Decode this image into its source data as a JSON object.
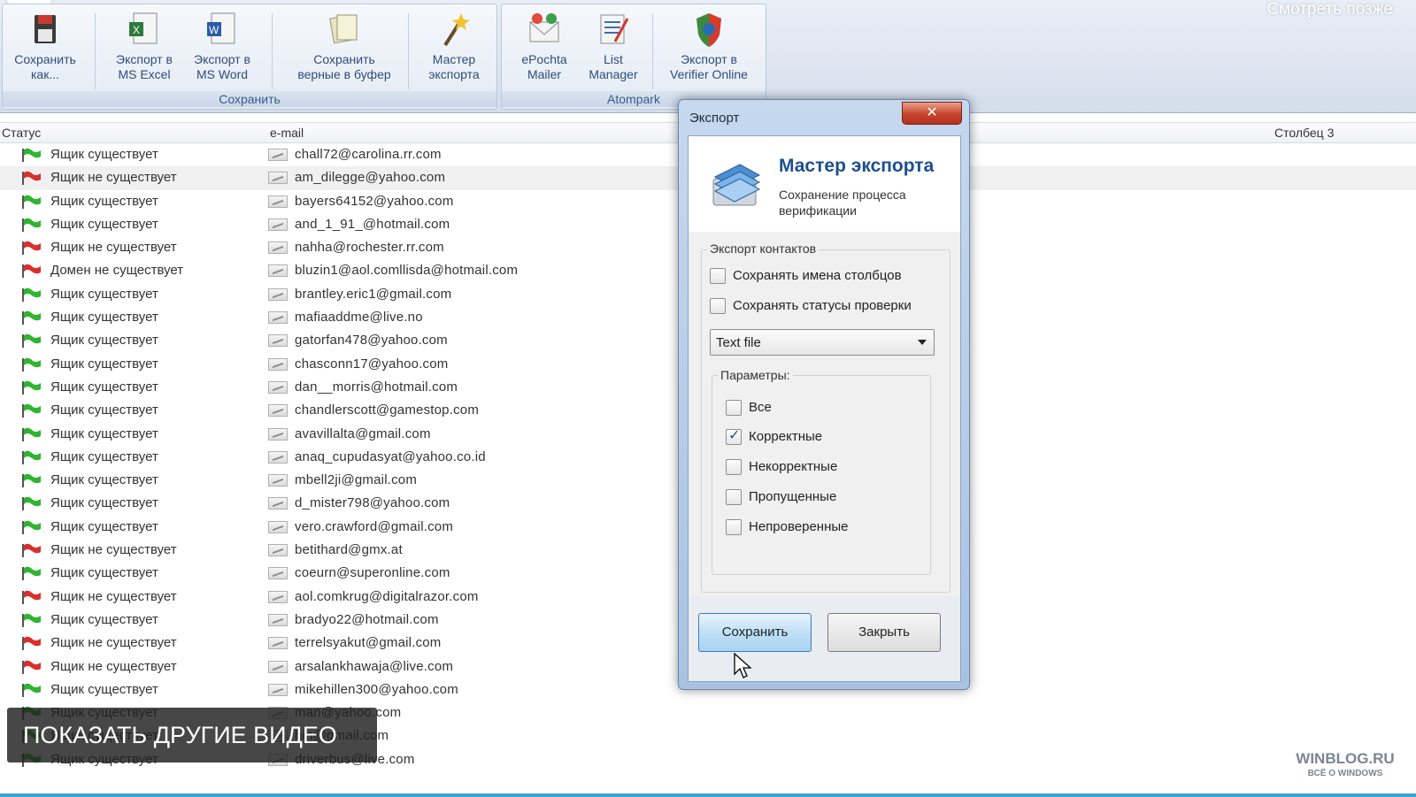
{
  "ribbon": {
    "watch_later": "Смотреть позже",
    "groups": [
      {
        "label": "Сохранить"
      },
      {
        "label": "Atompark"
      }
    ],
    "buttons": [
      {
        "label": "Сохранить\nкак...",
        "icon": "save-as-icon"
      },
      {
        "label": "Экспорт в\nMS Excel",
        "icon": "excel-export-icon"
      },
      {
        "label": "Экспорт в\nMS Word",
        "icon": "word-export-icon"
      },
      {
        "label": "Сохранить\nверные в буфер",
        "icon": "clipboard-save-icon"
      },
      {
        "label": "Мастер\nэкспорта",
        "icon": "export-wizard-icon"
      },
      {
        "label": "ePochta\nMailer",
        "icon": "epochta-mailer-icon"
      },
      {
        "label": "List\nManager",
        "icon": "list-manager-icon"
      },
      {
        "label": "Экспорт в\nVerifier Online",
        "icon": "verifier-online-icon"
      }
    ]
  },
  "table": {
    "columns": [
      "Статус",
      "e-mail",
      "Столбец 3"
    ],
    "rows": [
      {
        "status": "Ящик существует",
        "ok": true,
        "email": "chall72@carolina.rr.com"
      },
      {
        "status": "Ящик не существует",
        "ok": false,
        "email": "am_dilegge@yahoo.com"
      },
      {
        "status": "Ящик существует",
        "ok": true,
        "email": "bayers64152@yahoo.com"
      },
      {
        "status": "Ящик существует",
        "ok": true,
        "email": "and_1_91_@hotmail.com"
      },
      {
        "status": "Ящик не существует",
        "ok": false,
        "email": "nahha@rochester.rr.com"
      },
      {
        "status": "Домен не существует",
        "ok": false,
        "email": "bluzin1@aol.comllisda@hotmail.com"
      },
      {
        "status": "Ящик существует",
        "ok": true,
        "email": "brantley.eric1@gmail.com"
      },
      {
        "status": "Ящик существует",
        "ok": true,
        "email": "mafiaaddme@live.no"
      },
      {
        "status": "Ящик существует",
        "ok": true,
        "email": "gatorfan478@yahoo.com"
      },
      {
        "status": "Ящик существует",
        "ok": true,
        "email": "chasconn17@yahoo.com"
      },
      {
        "status": "Ящик существует",
        "ok": true,
        "email": "dan__morris@hotmail.com"
      },
      {
        "status": "Ящик существует",
        "ok": true,
        "email": "chandlerscott@gamestop.com"
      },
      {
        "status": "Ящик существует",
        "ok": true,
        "email": "avavillalta@gmail.com"
      },
      {
        "status": "Ящик существует",
        "ok": true,
        "email": "anaq_cupudasyat@yahoo.co.id"
      },
      {
        "status": "Ящик существует",
        "ok": true,
        "email": "mbell2ji@gmail.com"
      },
      {
        "status": "Ящик существует",
        "ok": true,
        "email": "d_mister798@yahoo.com"
      },
      {
        "status": "Ящик существует",
        "ok": true,
        "email": "vero.crawford@gmail.com"
      },
      {
        "status": "Ящик не существует",
        "ok": false,
        "email": "betithard@gmx.at"
      },
      {
        "status": "Ящик существует",
        "ok": true,
        "email": "coeurn@superonline.com"
      },
      {
        "status": "Ящик не существует",
        "ok": false,
        "email": "aol.comkrug@digitalrazor.com"
      },
      {
        "status": "Ящик существует",
        "ok": true,
        "email": "bradyo22@hotmail.com"
      },
      {
        "status": "Ящик не существует",
        "ok": false,
        "email": "terrelsyakut@gmail.com"
      },
      {
        "status": "Ящик не существует",
        "ok": false,
        "email": "arsalankhawaja@live.com"
      },
      {
        "status": "Ящик существует",
        "ok": true,
        "email": "mikehillen300@yahoo.com"
      },
      {
        "status": "Ящик существует",
        "ok": true,
        "email": "man@yahoo.com"
      },
      {
        "status": "Ящик существует",
        "ok": true,
        "email": "hin@gmail.com"
      },
      {
        "status": "Ящик существует",
        "ok": true,
        "email": "driverbus@live.com"
      }
    ]
  },
  "dialog": {
    "title": "Экспорт",
    "close_label": "✕",
    "wizard_title": "Мастер экспорта",
    "wizard_subtitle": "Сохранение процесса верификации",
    "contacts_group": "Экспорт контактов",
    "save_column_names": {
      "label": "Сохранять имена столбцов",
      "checked": false
    },
    "save_statuses": {
      "label": "Сохранять статусы проверки",
      "checked": false
    },
    "format_select": {
      "value": "Text file"
    },
    "params_group": "Параметры:",
    "params": [
      {
        "label": "Все",
        "checked": false
      },
      {
        "label": "Корректные",
        "checked": true
      },
      {
        "label": "Некорректные",
        "checked": false
      },
      {
        "label": "Пропущенные",
        "checked": false
      },
      {
        "label": "Непроверенные",
        "checked": false
      }
    ],
    "save_button": "Сохранить",
    "close_button": "Закрыть"
  },
  "overlay": {
    "more_videos": "ПОКАЗАТЬ ДРУГИЕ ВИДЕО",
    "watermark_main": "WINBLOG.RU",
    "watermark_sub": "ВСЁ О WINDOWS"
  },
  "colors": {
    "flag_ok": "#2fb52f",
    "flag_bad": "#d9302c",
    "accent": "#1c4f8f"
  }
}
